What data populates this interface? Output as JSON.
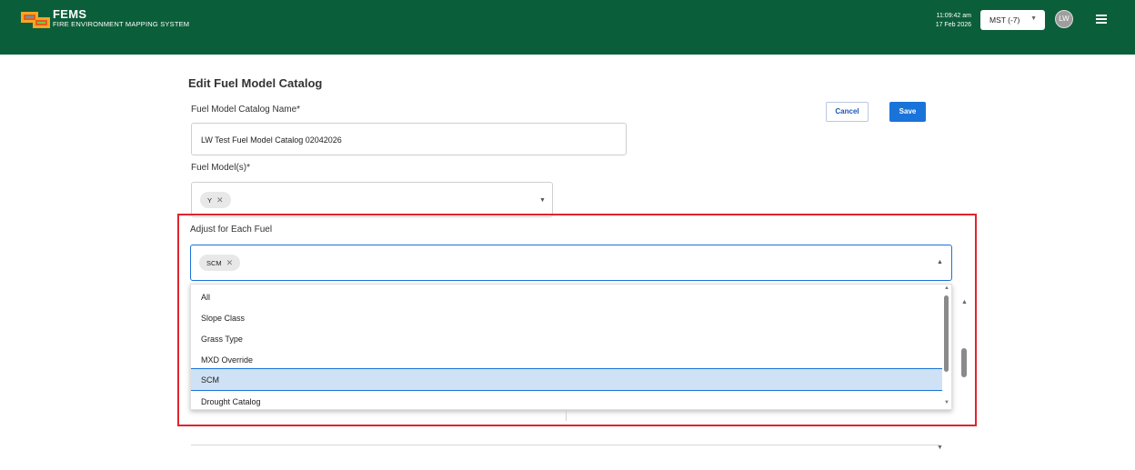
{
  "header": {
    "brand_title": "FEMS",
    "brand_subtitle": "FIRE ENVIRONMENT MAPPING SYSTEM",
    "time": "11:09:42 am",
    "date": "17 Feb 2026",
    "timezone": "MST (-7)",
    "avatar_initials": "LW",
    "colors": {
      "header_bg": "#0b5e3a",
      "accent": "#1a73d9",
      "highlight": "#e0242e"
    }
  },
  "form": {
    "title": "Edit Fuel Model Catalog",
    "catalog_name_label": "Fuel Model Catalog Name*",
    "catalog_name_value": "LW Test Fuel Model Catalog 02042026",
    "fuel_models_label": "Fuel Model(s)*",
    "fuel_model_chips": [
      "Y"
    ],
    "cancel_label": "Cancel",
    "save_label": "Save",
    "adjust_label": "Adjust for Each Fuel",
    "adjust_chips": [
      "SCM"
    ]
  },
  "dropdown": {
    "options": [
      "All",
      "Slope Class",
      "Grass Type",
      "MXD Override",
      "SCM",
      "Drought Catalog"
    ],
    "selected": "SCM"
  },
  "icons": {
    "chip_remove": "close-icon",
    "caret": "chevron-down-icon",
    "menu": "hamburger-icon"
  }
}
